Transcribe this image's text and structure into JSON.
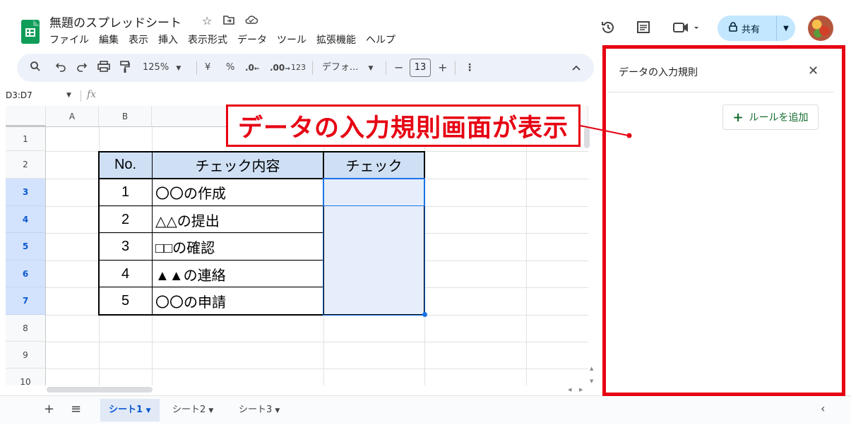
{
  "app": {
    "doc_title": "無題のスプレッドシート",
    "menu": [
      "ファイル",
      "編集",
      "表示",
      "挿入",
      "表示形式",
      "データ",
      "ツール",
      "拡張機能",
      "ヘルプ"
    ],
    "share_label": "共有",
    "accent": "#c2e7ff"
  },
  "toolbar": {
    "zoom": "125%",
    "currency": "¥",
    "percent": "%",
    "dec_decrease": ".0",
    "dec_increase": ".00",
    "number_format": "123",
    "font": "デフォ...",
    "font_size": "13",
    "minus": "−",
    "plus": "+"
  },
  "formula_bar": {
    "name_box": "D3:D7",
    "fx": "fx"
  },
  "grid": {
    "columns": [
      "A",
      "B"
    ],
    "rows": [
      "1",
      "2",
      "3",
      "4",
      "5",
      "6",
      "7",
      "8",
      "9",
      "10"
    ],
    "selected_rows": [
      "3",
      "4",
      "5",
      "6",
      "7"
    ],
    "table": {
      "headers": [
        "No.",
        "チェック内容",
        "チェック"
      ],
      "rows": [
        {
          "no": "1",
          "content": "〇〇の作成"
        },
        {
          "no": "2",
          "content": "△△の提出"
        },
        {
          "no": "3",
          "content": "□□の確認"
        },
        {
          "no": "4",
          "content": "▲▲の連絡"
        },
        {
          "no": "5",
          "content": "〇〇の申請"
        }
      ]
    }
  },
  "sheets": {
    "tabs": [
      "シート1",
      "シート2",
      "シート3"
    ],
    "active": "シート1"
  },
  "side_panel": {
    "title": "データの入力規則",
    "add_rule_label": "ルールを追加"
  },
  "annotation": {
    "text": "データの入力規則画面が表示",
    "color": "#e60012"
  }
}
